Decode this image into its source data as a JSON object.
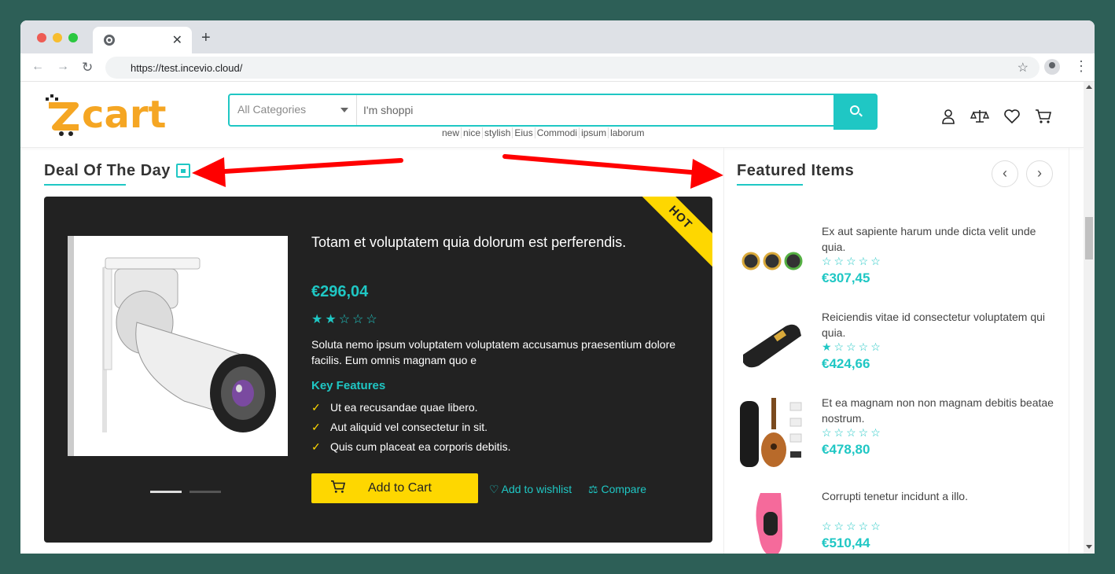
{
  "browser": {
    "url": "https://test.incevio.cloud/",
    "tab_title": ""
  },
  "header": {
    "logo_text": "zcart",
    "search": {
      "category": "All Categories",
      "query": "I'm shoppi"
    },
    "tags": [
      "new",
      "nice",
      "stylish",
      "Eius",
      "Commodi",
      "ipsum",
      "laborum"
    ],
    "icons": [
      "user-icon",
      "compare-icon",
      "heart-icon",
      "cart-icon"
    ]
  },
  "deal": {
    "title": "Deal Of The Day",
    "badge": "HOT",
    "product_name": "Totam et voluptatem quia dolorum est perferendis.",
    "price": "€296,04",
    "rating": 2,
    "stars": "★★☆☆☆",
    "description": "Soluta nemo ipsum voluptatem voluptatem accusamus praesentium dolore facilis. Eum omnis magnam quo e",
    "key_features_title": "Key Features",
    "features": [
      "Ut ea recusandae quae libero.",
      "Aut aliquid vel consectetur in sit.",
      "Quis cum placeat ea corporis debitis."
    ],
    "add_to_cart": "Add to Cart",
    "wishlist": "Add to wishlist",
    "compare": "Compare"
  },
  "featured": {
    "title": "Featured Items",
    "items": [
      {
        "name": "Ex aut sapiente harum unde dicta velit unde quia.",
        "rating": 0,
        "stars": "☆☆☆☆☆",
        "price": "€307,45"
      },
      {
        "name": "Reiciendis vitae id consectetur voluptatem qui quia.",
        "rating": 1,
        "stars": "★☆☆☆☆",
        "price": "€424,66"
      },
      {
        "name": "Et ea magnam non non magnam debitis beatae nostrum.",
        "rating": 0,
        "stars": "☆☆☆☆☆",
        "price": "€478,80"
      },
      {
        "name": "Corrupti tenetur incidunt a illo.",
        "rating": 0,
        "stars": "☆☆☆☆☆",
        "price": "€510,44"
      }
    ]
  },
  "colors": {
    "accent": "#1fc7c4",
    "button": "#fed700",
    "logo": "#f5a623",
    "annotation_arrow": "#ff0000",
    "backdrop": "#2d5f57"
  }
}
